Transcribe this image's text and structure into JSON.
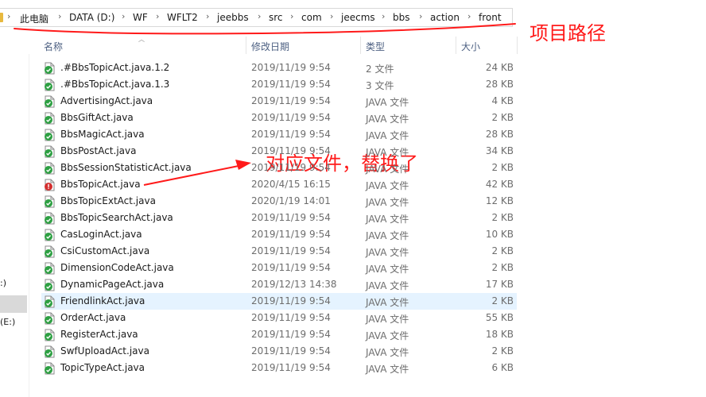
{
  "breadcrumb": {
    "items": [
      "此电脑",
      "DATA (D:)",
      "WF",
      "WFLT2",
      "jeebbs",
      "src",
      "com",
      "jeecms",
      "bbs",
      "action",
      "front"
    ]
  },
  "annotations": {
    "path_label": "项目路径",
    "file_label": "对应文件，替换了"
  },
  "columns": {
    "name": "名称",
    "date": "修改日期",
    "type": "类型",
    "size": "大小"
  },
  "leftnav": {
    "item1": ":)",
    "item2": "(E:)"
  },
  "files": [
    {
      "name": ".#BbsTopicAct.java.1.2",
      "date": "2019/11/19 9:54",
      "type": "2 文件",
      "size": "24 KB",
      "status": "ok"
    },
    {
      "name": ".#BbsTopicAct.java.1.3",
      "date": "2019/11/19 9:54",
      "type": "3 文件",
      "size": "28 KB",
      "status": "ok"
    },
    {
      "name": "AdvertisingAct.java",
      "date": "2019/11/19 9:54",
      "type": "JAVA 文件",
      "size": "4 KB",
      "status": "ok"
    },
    {
      "name": "BbsGiftAct.java",
      "date": "2019/11/19 9:54",
      "type": "JAVA 文件",
      "size": "2 KB",
      "status": "ok"
    },
    {
      "name": "BbsMagicAct.java",
      "date": "2019/11/19 9:54",
      "type": "JAVA 文件",
      "size": "28 KB",
      "status": "ok"
    },
    {
      "name": "BbsPostAct.java",
      "date": "2019/11/19 9:54",
      "type": "JAVA 文件",
      "size": "34 KB",
      "status": "ok"
    },
    {
      "name": "BbsSessionStatisticAct.java",
      "date": "2019/11/19 9:54",
      "type": "JAVA 文件",
      "size": "2 KB",
      "status": "ok"
    },
    {
      "name": "BbsTopicAct.java",
      "date": "2020/4/15 16:15",
      "type": "JAVA 文件",
      "size": "42 KB",
      "status": "modified"
    },
    {
      "name": "BbsTopicExtAct.java",
      "date": "2020/1/19 14:01",
      "type": "JAVA 文件",
      "size": "12 KB",
      "status": "ok"
    },
    {
      "name": "BbsTopicSearchAct.java",
      "date": "2019/11/19 9:54",
      "type": "JAVA 文件",
      "size": "2 KB",
      "status": "ok"
    },
    {
      "name": "CasLoginAct.java",
      "date": "2019/11/19 9:54",
      "type": "JAVA 文件",
      "size": "10 KB",
      "status": "ok"
    },
    {
      "name": "CsiCustomAct.java",
      "date": "2019/11/19 9:54",
      "type": "JAVA 文件",
      "size": "2 KB",
      "status": "ok"
    },
    {
      "name": "DimensionCodeAct.java",
      "date": "2019/11/19 9:54",
      "type": "JAVA 文件",
      "size": "2 KB",
      "status": "ok"
    },
    {
      "name": "DynamicPageAct.java",
      "date": "2019/12/13 14:38",
      "type": "JAVA 文件",
      "size": "17 KB",
      "status": "ok"
    },
    {
      "name": "FriendlinkAct.java",
      "date": "2019/11/19 9:54",
      "type": "JAVA 文件",
      "size": "2 KB",
      "status": "ok",
      "selected": true
    },
    {
      "name": "OrderAct.java",
      "date": "2019/11/19 9:54",
      "type": "JAVA 文件",
      "size": "55 KB",
      "status": "ok"
    },
    {
      "name": "RegisterAct.java",
      "date": "2019/11/19 9:54",
      "type": "JAVA 文件",
      "size": "18 KB",
      "status": "ok"
    },
    {
      "name": "SwfUploadAct.java",
      "date": "2019/11/19 9:54",
      "type": "JAVA 文件",
      "size": "2 KB",
      "status": "ok"
    },
    {
      "name": "TopicTypeAct.java",
      "date": "2019/11/19 9:54",
      "type": "JAVA 文件",
      "size": "6 KB",
      "status": "ok"
    }
  ],
  "icons": {
    "ok": "green-check-file-icon",
    "modified": "red-exclamation-file-icon"
  },
  "colors": {
    "annotation": "#ff1a1a",
    "ok_badge": "#2ea043",
    "modified_badge": "#d32f2f",
    "selected_row": "#e5f3ff",
    "column_header": "#4d6082"
  }
}
